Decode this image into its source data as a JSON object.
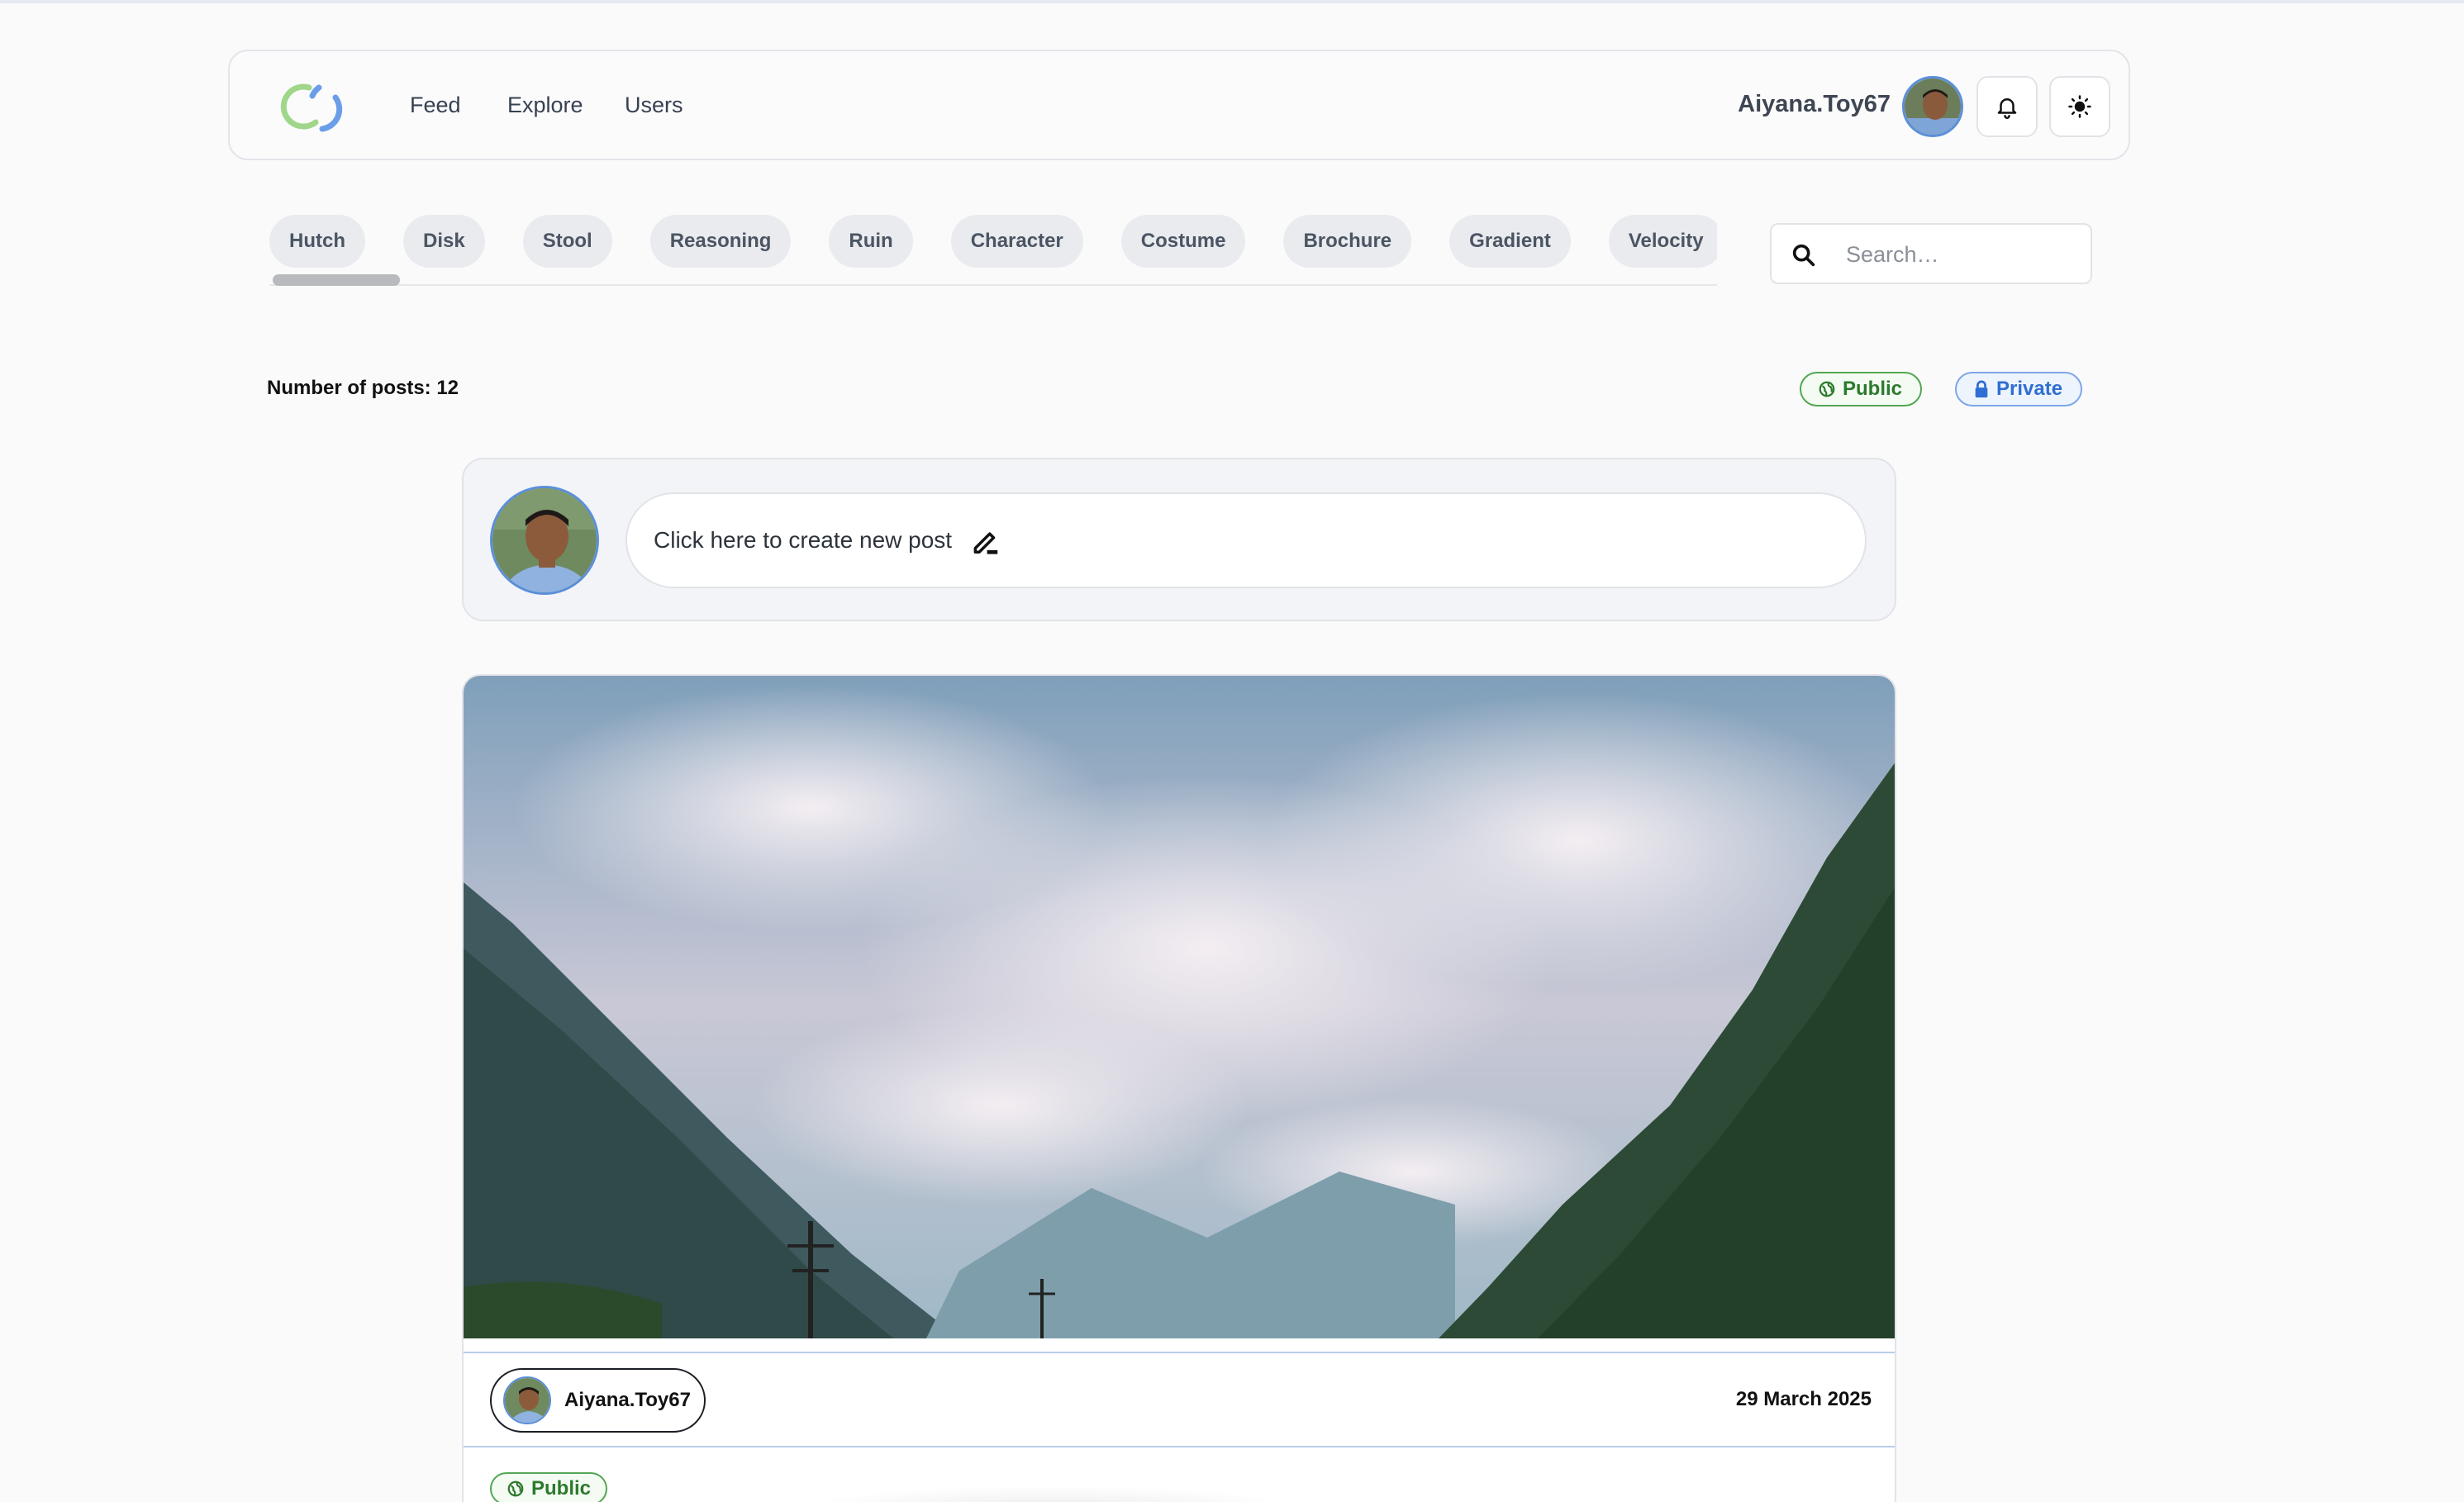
{
  "header": {
    "nav": [
      "Feed",
      "Explore",
      "Users"
    ],
    "username": "Aiyana.Toy67",
    "notification_icon": "bell-icon",
    "theme_icon": "sun-icon"
  },
  "tags": [
    "Hutch",
    "Disk",
    "Stool",
    "Reasoning",
    "Ruin",
    "Character",
    "Costume",
    "Brochure",
    "Gradient",
    "Velocity"
  ],
  "search": {
    "placeholder": "Search…"
  },
  "posts_summary": {
    "count_label": "Number of posts: 12"
  },
  "filters": {
    "public_label": "Public",
    "private_label": "Private"
  },
  "create_post": {
    "prompt": "Click here to create new post"
  },
  "post": {
    "author": "Aiyana.Toy67",
    "date": "29 March 2025",
    "visibility": "Public",
    "image_alt": "mountain valley with clouds"
  },
  "colors": {
    "public_green": "#2c7a2c",
    "private_blue": "#2f6fd1",
    "avatar_ring": "#5b8fd9"
  }
}
